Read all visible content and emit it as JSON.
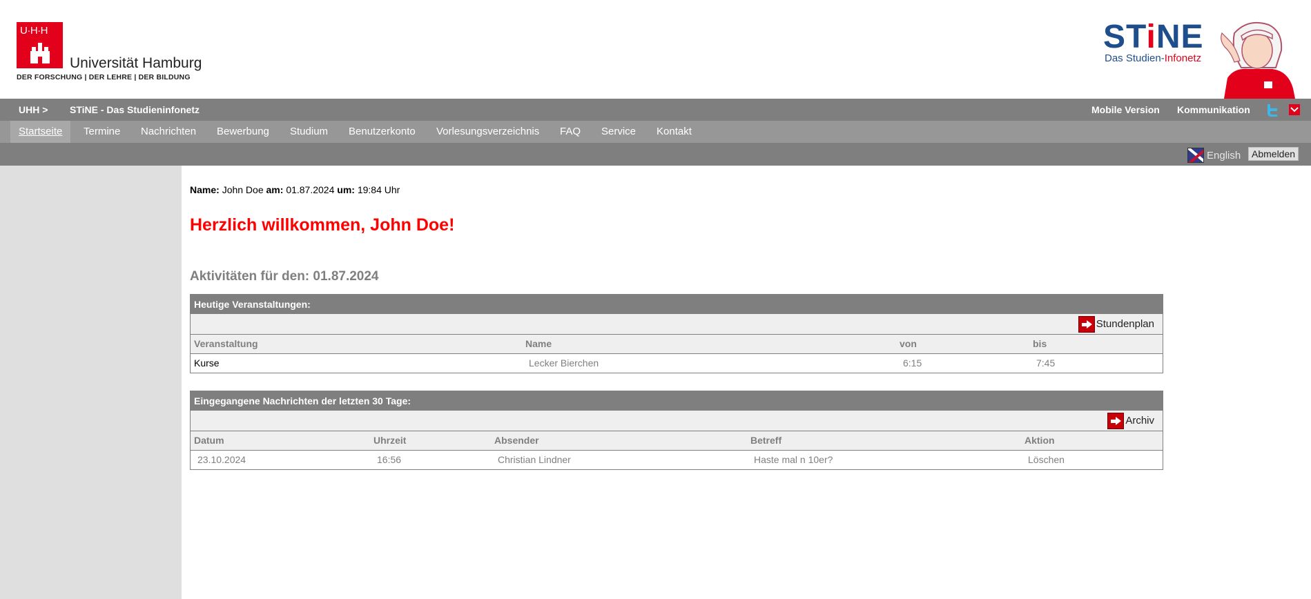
{
  "header": {
    "uhh_letters": "U·H·H",
    "university_name": "Universität Hamburg",
    "university_tagline": "DER FORSCHUNG | DER LEHRE | DER BILDUNG",
    "stine_word_part1": "ST",
    "stine_word_i": "i",
    "stine_word_part2": "NE",
    "stine_subtitle_part1": "Das Studien-",
    "stine_subtitle_part2": "Infonetz"
  },
  "topbar": {
    "crumb_uhh": "UHH >",
    "crumb_stine": "STiNE - Das Studieninfonetz",
    "mobile": "Mobile Version",
    "kommunikation": "Kommunikation"
  },
  "nav": {
    "items": [
      "Startseite",
      "Termine",
      "Nachrichten",
      "Bewerbung",
      "Studium",
      "Benutzerkonto",
      "Vorlesungsverzeichnis",
      "FAQ",
      "Service",
      "Kontakt"
    ],
    "active": "Startseite"
  },
  "subbar": {
    "language": "English",
    "logout": "Abmelden"
  },
  "main": {
    "name_label": "Name:",
    "name_value": "John Doe",
    "date_label": "am:",
    "date_value": "01.87.2024",
    "time_label": "um:",
    "time_value": "19:84 Uhr",
    "welcome": "Herzlich willkommen, John Doe!",
    "activities_title": "Aktivitäten für den: 01.87.2024"
  },
  "events": {
    "title": "Heutige Veranstaltungen:",
    "tool_link": "Stundenplan",
    "columns": [
      "Veranstaltung",
      "Name",
      "von",
      "bis"
    ],
    "rows": [
      {
        "veranstaltung": "Kurse",
        "name": "Lecker Bierchen",
        "von": "6:15",
        "bis": "7:45"
      }
    ]
  },
  "messages": {
    "title": "Eingegangene Nachrichten der letzten 30 Tage:",
    "tool_link": "Archiv",
    "columns": [
      "Datum",
      "Uhrzeit",
      "Absender",
      "Betreff",
      "Aktion"
    ],
    "rows": [
      {
        "datum": "23.10.2024",
        "uhrzeit": "16:56",
        "absender": "Christian Lindner",
        "betreff": "Haste mal n 10er?",
        "aktion": "Löschen"
      }
    ]
  }
}
